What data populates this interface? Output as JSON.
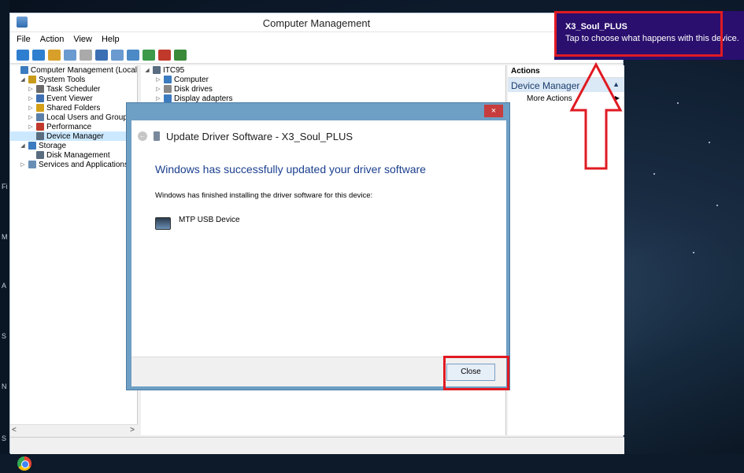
{
  "window": {
    "title": "Computer Management",
    "menu": [
      "File",
      "Action",
      "View",
      "Help"
    ]
  },
  "tree": {
    "items": [
      {
        "label": "Computer Management (Local",
        "indent": 0,
        "arrow": "",
        "color": "#3b7bbf"
      },
      {
        "label": "System Tools",
        "indent": 1,
        "arrow": "◢",
        "color": "#c99b1a"
      },
      {
        "label": "Task Scheduler",
        "indent": 2,
        "arrow": "▷",
        "color": "#6a6a6a"
      },
      {
        "label": "Event Viewer",
        "indent": 2,
        "arrow": "▷",
        "color": "#3d6fb3"
      },
      {
        "label": "Shared Folders",
        "indent": 2,
        "arrow": "▷",
        "color": "#d4a017"
      },
      {
        "label": "Local Users and Group",
        "indent": 2,
        "arrow": "▷",
        "color": "#5b7fa8"
      },
      {
        "label": "Performance",
        "indent": 2,
        "arrow": "▷",
        "color": "#c0392b"
      },
      {
        "label": "Device Manager",
        "indent": 2,
        "arrow": "",
        "color": "#5a6d80",
        "selected": true
      },
      {
        "label": "Storage",
        "indent": 1,
        "arrow": "◢",
        "color": "#3b7bbf"
      },
      {
        "label": "Disk Management",
        "indent": 2,
        "arrow": "",
        "color": "#5a6d80"
      },
      {
        "label": "Services and Applications",
        "indent": 1,
        "arrow": "▷",
        "color": "#6a8fb5"
      }
    ]
  },
  "devices": {
    "root": "ITC95",
    "children": [
      "Computer",
      "Disk drives",
      "Display adapters"
    ]
  },
  "actions": {
    "header": "Actions",
    "section": "Device Manager",
    "more": "More Actions"
  },
  "dialog": {
    "close_x": "×",
    "back": "←",
    "title": "Update Driver Software - X3_Soul_PLUS",
    "heading": "Windows has successfully updated your driver software",
    "text": "Windows has finished installing the driver software for this device:",
    "device": "MTP USB Device",
    "close_button": "Close"
  },
  "toast": {
    "title": "X3_Soul_PLUS",
    "text": "Tap to choose what happens with this device."
  },
  "scroll": {
    "left": "<",
    "right": ">"
  },
  "colors": {
    "accent": "#1b3f8f",
    "highlight": "#e01a22",
    "toast_bg": "#2a0f6e"
  }
}
